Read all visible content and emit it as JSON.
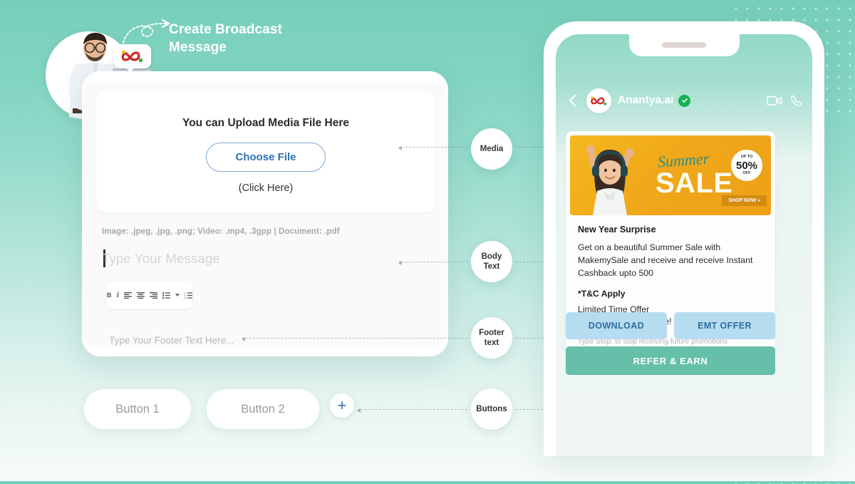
{
  "header": {
    "title_line1": "Create Broadcast",
    "title_line2": "Message"
  },
  "editor": {
    "dropzone_title": "You can Upload Media File Here",
    "choose_file_label": "Choose File",
    "click_here_label": "(Click Here)",
    "format_hint": "Image: .jpeg, .jpg, .png; Video: .mp4, .3gpp  |  Document: .pdf",
    "message_placeholder": "Type Your Message",
    "footer_placeholder": "Type Your Footer Text Here...",
    "toolbar": [
      {
        "name": "bold-icon",
        "glyph": "B"
      },
      {
        "name": "italic-icon",
        "glyph": "I"
      },
      {
        "name": "align-left-icon",
        "glyph": ""
      },
      {
        "name": "align-center-icon",
        "glyph": ""
      },
      {
        "name": "align-right-icon",
        "glyph": ""
      },
      {
        "name": "bullet-list-icon",
        "glyph": ""
      },
      {
        "name": "chevron-down-icon",
        "glyph": ""
      },
      {
        "name": "numbered-list-icon",
        "glyph": ""
      }
    ]
  },
  "buttons_row": {
    "button1_label": "Button 1",
    "button2_label": "Button 2",
    "add_label": "+"
  },
  "callouts": {
    "media": "Media",
    "body_line1": "Body",
    "body_line2": "Text",
    "footer_line1": "Footer",
    "footer_line2": "text",
    "buttons": "Buttons"
  },
  "phone": {
    "chat_name": "Anantya.ai",
    "verified": true,
    "banner": {
      "summer_text": "Summer",
      "sale_text": "SALE",
      "badge_upto": "UP TO",
      "badge_percent": "50%",
      "badge_off": "OFF",
      "shop_now": "SHOP NOW »"
    },
    "message": {
      "title": "New Year Surprise",
      "body": "Get on a beautiful Summer Sale with MakemySale and receive and receive Instant Cashback upto 500",
      "tc": "*T&C Apply",
      "sub_line1": "Limited Time Offer",
      "sub_line2": "Grab it Before it’s Gone!",
      "footer": "Type Stop, to stop receiving future promotions"
    },
    "cta": {
      "download": "DOWNLOAD",
      "emt_offer": "EMT OFFER",
      "refer_earn": "REFER & EARN"
    }
  },
  "colors": {
    "background_top": "#76cfba",
    "accent_blue": "#2f6fb5",
    "banner_yellow": "#f0a81a",
    "cta_light": "#b6dcef",
    "cta_teal": "#66bfa9",
    "verified_green": "#14b352"
  }
}
